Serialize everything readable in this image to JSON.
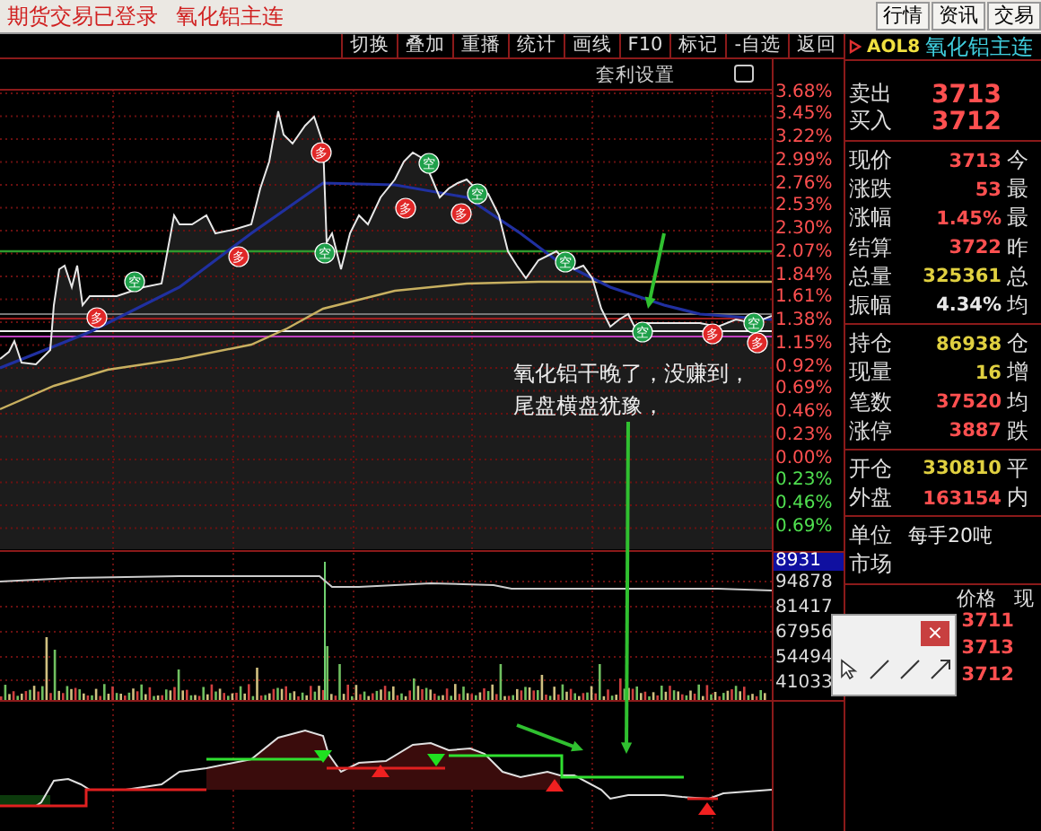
{
  "title_bar": {
    "status": "期货交易已登录",
    "instrument": "氧化铝主连",
    "buttons": [
      "行情",
      "资讯",
      "交易"
    ]
  },
  "toolbar": [
    "切换",
    "叠加",
    "重播",
    "统计",
    "画线",
    "F10",
    "标记",
    "-自选",
    "返回"
  ],
  "chart": {
    "settings_label": "套利设置",
    "price_axis": [
      {
        "label": "3.68%",
        "kind": "up"
      },
      {
        "label": "3.45%",
        "kind": "up"
      },
      {
        "label": "3.22%",
        "kind": "up"
      },
      {
        "label": "2.99%",
        "kind": "up"
      },
      {
        "label": "2.76%",
        "kind": "up"
      },
      {
        "label": "2.53%",
        "kind": "up"
      },
      {
        "label": "2.30%",
        "kind": "up"
      },
      {
        "label": "2.07%",
        "kind": "up"
      },
      {
        "label": "1.84%",
        "kind": "up"
      },
      {
        "label": "1.61%",
        "kind": "up"
      },
      {
        "label": "1.38%",
        "kind": "up"
      },
      {
        "label": "1.15%",
        "kind": "up"
      },
      {
        "label": "0.92%",
        "kind": "up"
      },
      {
        "label": "0.69%",
        "kind": "up"
      },
      {
        "label": "0.46%",
        "kind": "up"
      },
      {
        "label": "0.23%",
        "kind": "up"
      },
      {
        "label": "0.00%",
        "kind": "up"
      },
      {
        "label": "0.23%",
        "kind": "down"
      },
      {
        "label": "0.46%",
        "kind": "down"
      },
      {
        "label": "0.69%",
        "kind": "down"
      }
    ],
    "volume_axis": [
      {
        "label": "8931",
        "highlighted": true
      },
      {
        "label": "94878",
        "highlighted": false
      },
      {
        "label": "81417",
        "highlighted": false
      },
      {
        "label": "67956",
        "highlighted": false
      },
      {
        "label": "54494",
        "highlighted": false
      },
      {
        "label": "41033",
        "highlighted": false
      }
    ],
    "signals": [
      {
        "kind": "long",
        "label": "多"
      },
      {
        "kind": "short",
        "label": "空"
      },
      {
        "kind": "long",
        "label": "多"
      },
      {
        "kind": "long",
        "label": "多"
      },
      {
        "kind": "short",
        "label": "空"
      },
      {
        "kind": "short",
        "label": "空"
      },
      {
        "kind": "long",
        "label": "多"
      },
      {
        "kind": "long",
        "label": "多"
      },
      {
        "kind": "short",
        "label": "空"
      },
      {
        "kind": "short",
        "label": "空"
      },
      {
        "kind": "short",
        "label": "空"
      },
      {
        "kind": "long",
        "label": "多"
      },
      {
        "kind": "short",
        "label": "空"
      },
      {
        "kind": "long",
        "label": "多"
      }
    ],
    "annotation": [
      "氧化铝干晚了，没赚到，",
      "尾盘横盘犹豫，"
    ]
  },
  "quote": {
    "code": "AOL8",
    "name": "氧化铝主连",
    "groups": [
      [
        {
          "label": "卖出",
          "value": "3713",
          "color": "#ff5050",
          "big": true
        },
        {
          "label": "买入",
          "value": "3712",
          "color": "#ff5050",
          "big": true
        }
      ],
      [
        {
          "label": "现价",
          "value": "3713",
          "color": "#ff5050",
          "side": "今"
        },
        {
          "label": "涨跌",
          "value": "53",
          "color": "#ff5050",
          "side": "最"
        },
        {
          "label": "涨幅",
          "value": "1.45%",
          "color": "#ff5050",
          "side": "最"
        },
        {
          "label": "结算",
          "value": "3722",
          "color": "#ff5050",
          "side": "昨"
        },
        {
          "label": "总量",
          "value": "325361",
          "color": "#e0d040",
          "side": "总"
        },
        {
          "label": "振幅",
          "value": "4.34%",
          "color": "#e8e8e8",
          "side": "均"
        }
      ],
      [
        {
          "label": "持仓",
          "value": "86938",
          "color": "#e0d040",
          "side": "仓"
        },
        {
          "label": "现量",
          "value": "16",
          "color": "#e0d040",
          "side": "增"
        },
        {
          "label": "笔数",
          "value": "37520",
          "color": "#ff5050",
          "side": "均"
        },
        {
          "label": "涨停",
          "value": "3887",
          "color": "#ff5050",
          "side": "跌"
        }
      ],
      [
        {
          "label": "开仓",
          "value": "330810",
          "color": "#e0d040",
          "side": "平"
        },
        {
          "label": "外盘",
          "value": "163154",
          "color": "#ff5050",
          "side": "内"
        }
      ],
      [
        {
          "label": "单位",
          "value": "每手20吨",
          "color": "#e8e8e8"
        },
        {
          "label": "市场"
        }
      ]
    ],
    "trades": {
      "columns": [
        "价格",
        "现"
      ],
      "rows": [
        {
          "price": "3711"
        },
        {
          "price": "3713"
        },
        {
          "price": "3712"
        }
      ]
    }
  },
  "popup": {
    "close": "×"
  }
}
